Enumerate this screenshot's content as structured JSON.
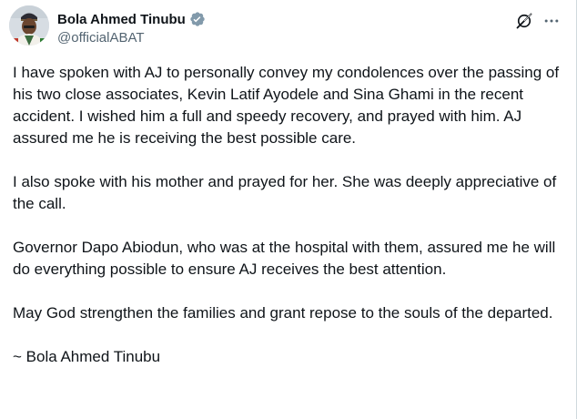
{
  "author": {
    "display_name": "Bola Ahmed Tinubu",
    "handle": "@officialABAT",
    "verified_color": "#829aab"
  },
  "actions": {
    "grok_icon": "grok-icon",
    "more_icon": "more-horizontal-icon"
  },
  "post": {
    "paragraphs": [
      "I have spoken with AJ to personally convey my condolences over the passing of his two close associates, Kevin Latif Ayodele and Sina Ghami in the recent accident. I wished him a full and speedy recovery, and prayed with him. AJ assured me he is receiving the best possible care.",
      "I also spoke with his mother and prayed for her. She was deeply appreciative of the call.",
      "Governor Dapo Abiodun, who was at the hospital with them, assured me he will do everything possible to ensure AJ receives the best attention.",
      "May God strengthen the families and grant repose to the souls of the departed.",
      "~ Bola Ahmed Tinubu"
    ]
  }
}
